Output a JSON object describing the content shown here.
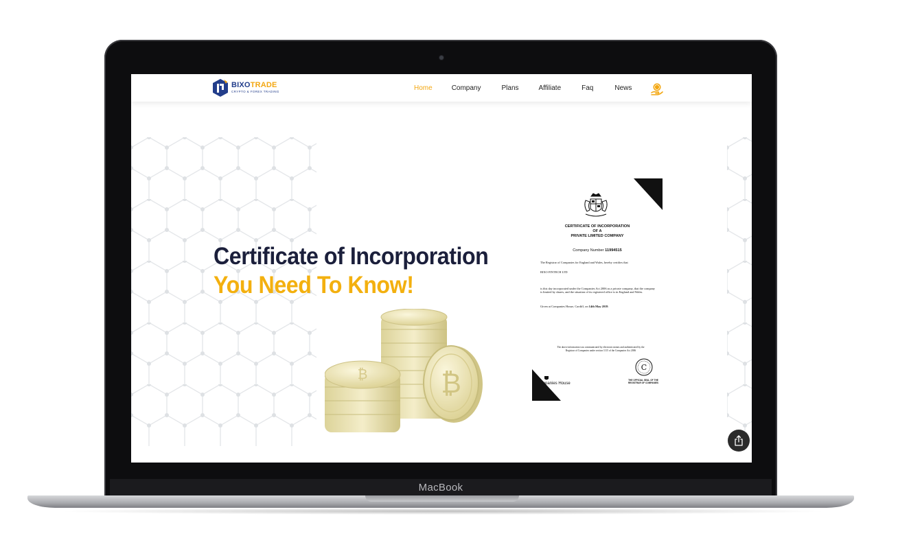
{
  "device": {
    "bezel_label": "MacBook"
  },
  "site": {
    "logo": {
      "name_part1": "BIXO",
      "name_part2": "TRADE",
      "tagline": "CRYPTO & FOREX TRADING"
    },
    "nav": {
      "items": [
        {
          "label": "Home",
          "active": true
        },
        {
          "label": "Company",
          "active": false
        },
        {
          "label": "Plans",
          "active": false
        },
        {
          "label": "Affiliate",
          "active": false
        },
        {
          "label": "Faq",
          "active": false
        },
        {
          "label": "News",
          "active": false
        }
      ],
      "wallet_icon": "coin-hand-icon"
    },
    "hero": {
      "title": "Certificate of Incorporation",
      "subtitle": "You Need To Know!"
    },
    "certificate": {
      "heading_lines": [
        "CERTIFICATE OF INCORPORATION",
        "OF A",
        "PRIVATE LIMITED COMPANY"
      ],
      "company_number_label": "Company Number",
      "company_number": "11994515",
      "para1": "The Registrar of Companies for England and Wales, hereby certifies that",
      "company_name": "BIXO FINTECH LTD",
      "para2": "is this day incorporated under the Companies Act 2006 as a private company, that the company is limited by shares, and the situation of its registered office is in England and Wales.",
      "given_at": "Given at Companies House, Cardiff, on",
      "date": "14th May 2019",
      "footnote": "The above information was communicated by electronic means and authenticated by the Registrar of Companies under section 1115 of the Companies Act 2006",
      "companies_house_label": "mpanies House",
      "seal_text": "THE OFFICIAL SEAL OF THE REGISTRAR OF COMPANIES"
    },
    "share_button_icon": "share-icon",
    "colors": {
      "accent": "#f3b00f",
      "navy": "#1b1f3b",
      "logo_blue": "#233e8b"
    }
  }
}
